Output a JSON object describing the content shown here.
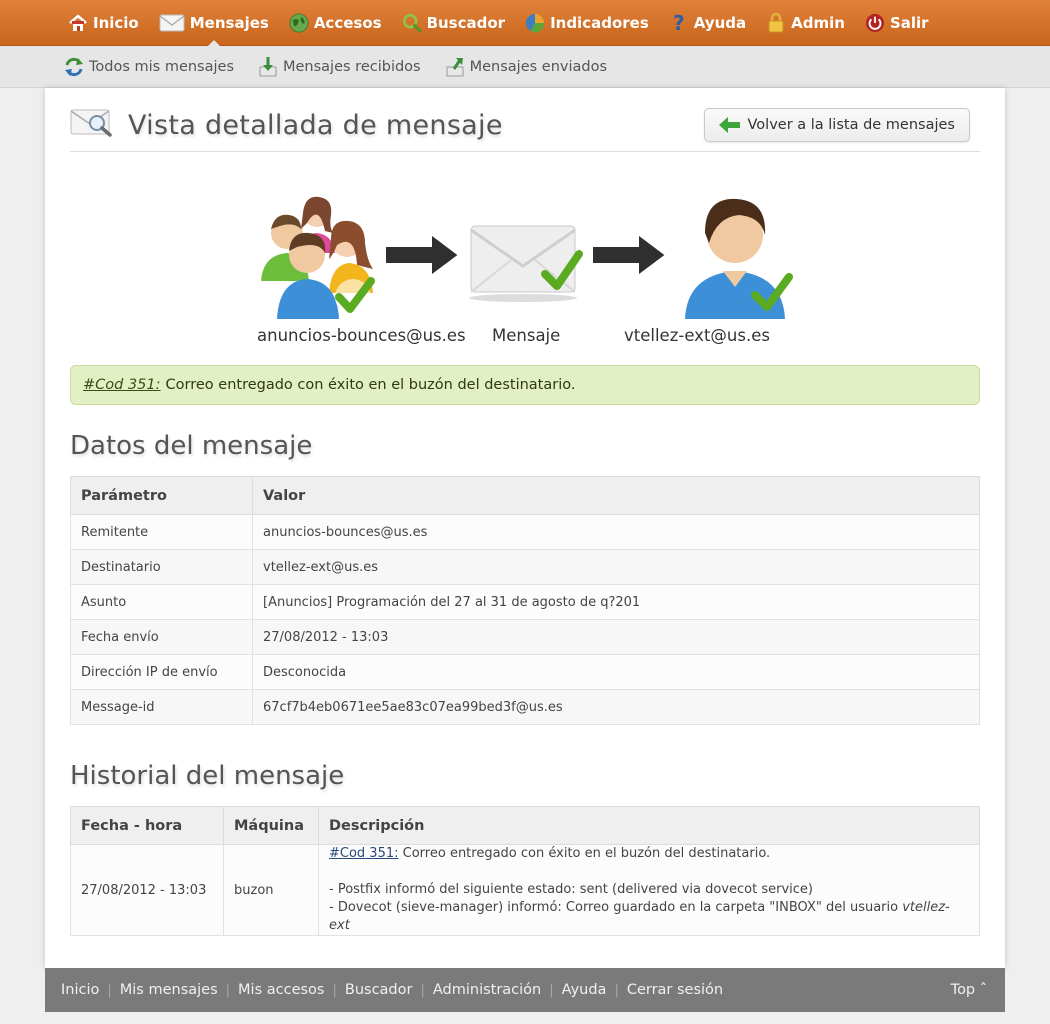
{
  "nav": {
    "items": [
      {
        "label": "Inicio",
        "icon": "home-icon"
      },
      {
        "label": "Mensajes",
        "icon": "envelope-icon"
      },
      {
        "label": "Accesos",
        "icon": "globe-icon"
      },
      {
        "label": "Buscador",
        "icon": "magnifier-icon"
      },
      {
        "label": "Indicadores",
        "icon": "pie-chart-icon"
      },
      {
        "label": "Ayuda",
        "icon": "question-icon"
      },
      {
        "label": "Admin",
        "icon": "lock-icon"
      },
      {
        "label": "Salir",
        "icon": "power-icon"
      }
    ],
    "active": "Mensajes"
  },
  "subnav": {
    "items": [
      {
        "label": "Todos mis mensajes",
        "icon": "refresh-icon"
      },
      {
        "label": "Mensajes recibidos",
        "icon": "inbox-download-icon"
      },
      {
        "label": "Mensajes enviados",
        "icon": "outbox-upload-icon"
      }
    ]
  },
  "page": {
    "title": "Vista detallada de mensaje",
    "back_button": "Volver a la lista de mensajes"
  },
  "flow": {
    "sender": "anuncios-bounces@us.es",
    "message": "Mensaje",
    "recipient": "vtellez-ext@us.es"
  },
  "alert": {
    "code": "#Cod 351:",
    "text": "Correo entregado con éxito en el buzón del destinatario."
  },
  "datos": {
    "title": "Datos del mensaje",
    "headers": [
      "Parámetro",
      "Valor"
    ],
    "rows": [
      {
        "param": "Remitente",
        "value": "anuncios-bounces@us.es"
      },
      {
        "param": "Destinatario",
        "value": "vtellez-ext@us.es"
      },
      {
        "param": "Asunto",
        "value": "[Anuncios] Programación del 27 al 31 de agosto de q?201"
      },
      {
        "param": "Fecha envío",
        "value": "27/08/2012 - 13:03"
      },
      {
        "param": "Dirección IP de envío",
        "value": "Desconocida"
      },
      {
        "param": "Message-id",
        "value": "67cf7b4eb0671ee5ae83c07ea99bed3f@us.es"
      }
    ]
  },
  "historial": {
    "title": "Historial del mensaje",
    "headers": [
      "Fecha - hora",
      "Máquina",
      "Descripción"
    ],
    "rows": [
      {
        "fecha": "27/08/2012 - 13:03",
        "maquina": "buzon",
        "code": "#Cod 351:",
        "line1": "Correo entregado con éxito en el buzón del destinatario.",
        "line2": "- Postfix informó del siguiente estado: sent (delivered via dovecot service)",
        "line3_prefix": "- Dovecot (sieve-manager) informó: Correo guardado en la carpeta \"INBOX\" del usuario ",
        "line3_user": "vtellez-ext"
      }
    ]
  },
  "footer": {
    "links": [
      "Inicio",
      "Mis mensajes",
      "Mis accesos",
      "Buscador",
      "Administración",
      "Ayuda",
      "Cerrar sesión"
    ],
    "top": "Top ˆ"
  },
  "colors": {
    "nav_bg": "#d9732b",
    "success_bg": "#e3efc4",
    "footer_bg": "#7a7a7a"
  }
}
